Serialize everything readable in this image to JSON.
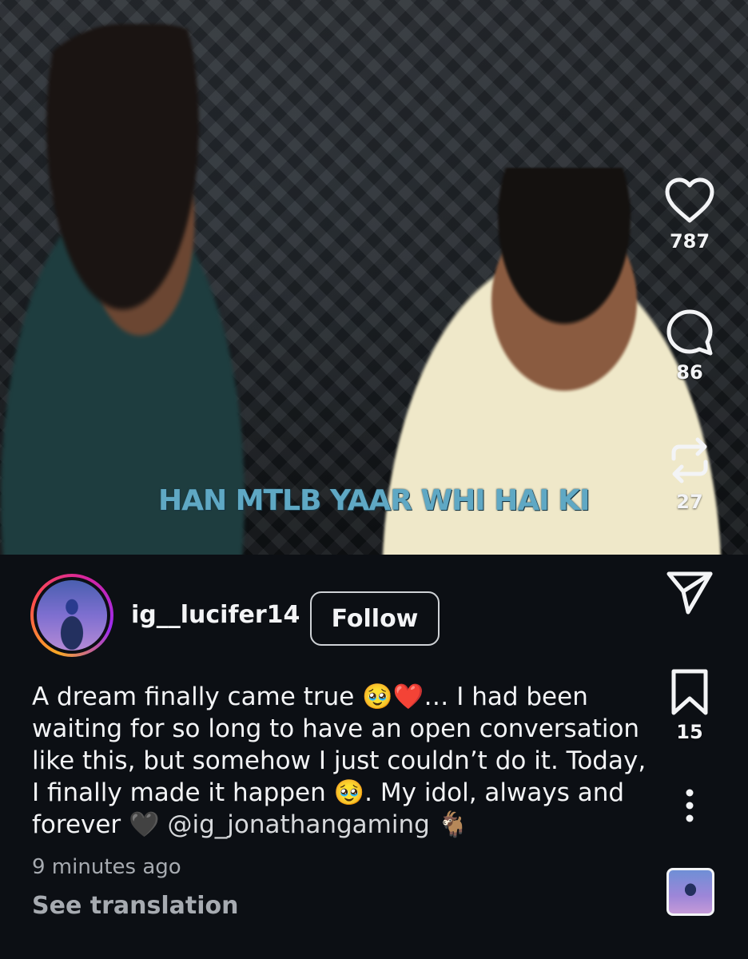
{
  "video": {
    "overlay_caption": "HAN MTLB YAAR WHI HAI KI"
  },
  "actions": {
    "like": {
      "icon": "heart-icon",
      "count": "787"
    },
    "comment": {
      "icon": "comment-bubble-icon",
      "count": "86"
    },
    "repost": {
      "icon": "repost-icon",
      "count": "27"
    },
    "share": {
      "icon": "send-icon"
    },
    "save": {
      "icon": "bookmark-icon",
      "count": "15"
    },
    "more": {
      "icon": "more-vertical-icon"
    },
    "audio": {
      "icon": "audio-thumbnail"
    }
  },
  "author": {
    "username": "ig__lucifer14",
    "follow_label": "Follow"
  },
  "post": {
    "caption_part1": "A dream finally came true 🥹❤️… I had been waiting for so long to have an open conversation like this, but somehow I just couldn’t do it. Today, I finally made it happen 🥹. My idol, always and forever 🖤 ",
    "mention": "@ig_jonathangaming",
    "caption_part2": " 🐐",
    "time_ago": "9 minutes ago",
    "translate_label": "See translation"
  },
  "colors": {
    "background": "#0c0f14",
    "overlay_caption": "#5fa8c4",
    "story_ring": [
      "#f9a825",
      "#ff4d4d",
      "#d6249f",
      "#9b2cf0"
    ]
  }
}
